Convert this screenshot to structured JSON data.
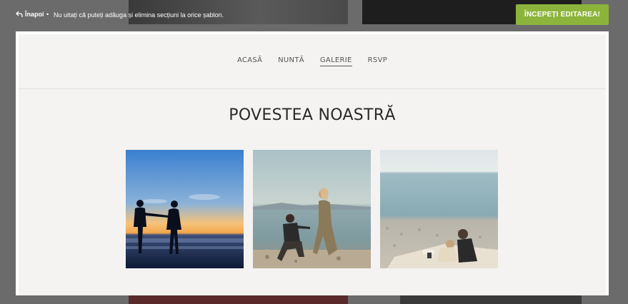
{
  "topbar": {
    "back_label": "Înapoi",
    "hint": "Nu uitați că puteți adăuga și elimina secțiuni la orice șablon.",
    "start_button": "ÎNCEPEȚI EDITAREA!"
  },
  "nav": {
    "items": [
      "ACASĂ",
      "NUNTĂ",
      "GALERIE",
      "RSVP"
    ],
    "active": "GALERIE"
  },
  "section": {
    "title": "POVESTEA NOASTRĂ"
  },
  "gallery": {
    "photos": [
      "couple-sunset-beach",
      "proposal-on-beach",
      "couple-sitting-shore"
    ]
  },
  "colors": {
    "accent": "#8cb43a",
    "page_bg": "#f4f3f1"
  }
}
